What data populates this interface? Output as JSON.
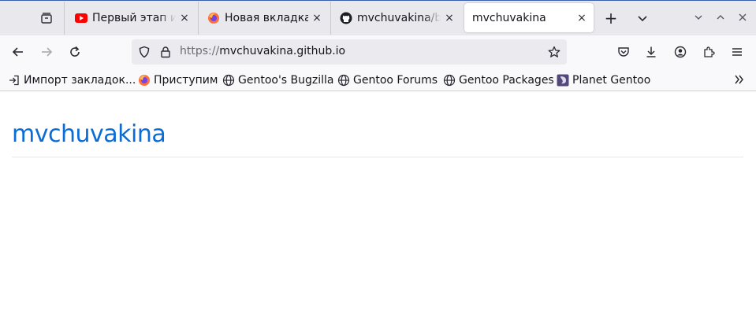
{
  "tabs": [
    {
      "title": "Первый этап индексации",
      "favicon": "youtube-icon",
      "active": false
    },
    {
      "title": "Новая вкладка",
      "favicon": "firefox-icon",
      "active": false
    },
    {
      "title": "mvchuvakina/blog",
      "favicon": "github-icon",
      "active": false
    },
    {
      "title": "mvchuvakina",
      "favicon": "none",
      "active": true
    }
  ],
  "tabbar": {
    "close_symbol": "×",
    "new_tab_symbol": "+",
    "list_tabs_symbol": "⌄"
  },
  "address": {
    "protocol": "https://",
    "host": "mvchuvakina.github.io"
  },
  "bookmarks": [
    {
      "label": "Импорт закладок...",
      "icon": "import-icon"
    },
    {
      "label": "Приступим",
      "icon": "firefox-icon"
    },
    {
      "label": "Gentoo's Bugzilla",
      "icon": "globe-icon"
    },
    {
      "label": "Gentoo Forums",
      "icon": "globe-icon"
    },
    {
      "label": "Gentoo Packages",
      "icon": "globe-icon"
    },
    {
      "label": "Planet Gentoo",
      "icon": "planet-gentoo-icon"
    }
  ],
  "page": {
    "title": "mvchuvakina"
  },
  "colors": {
    "link_blue": "#0a6cd6",
    "tabstrip": "#e8e8ed",
    "navbar": "#f9f9fb"
  }
}
